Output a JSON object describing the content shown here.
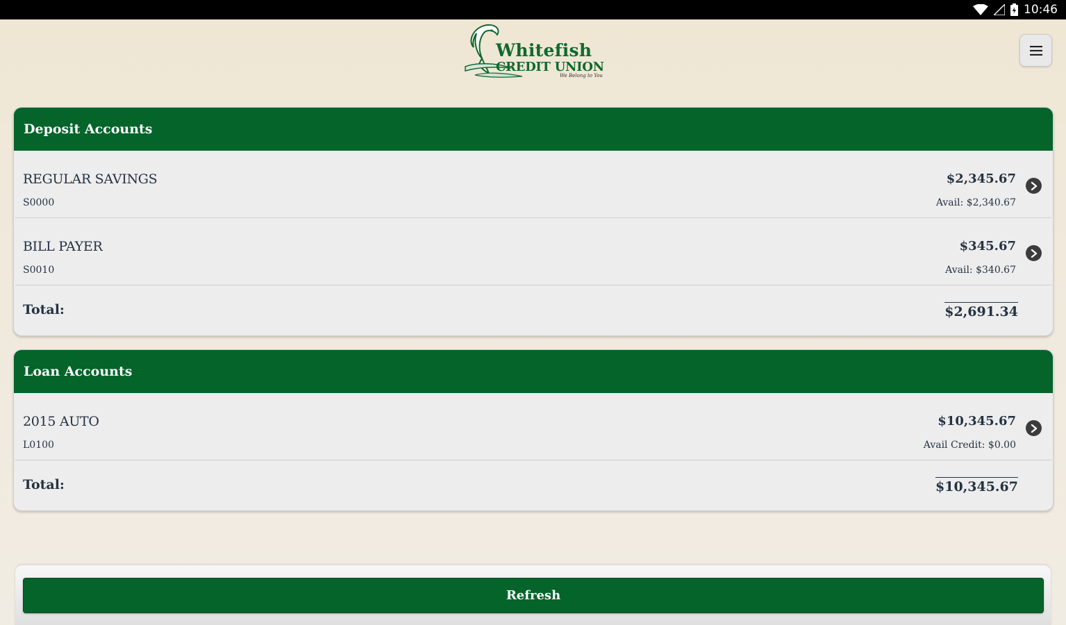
{
  "status_bar": {
    "time": "10:46"
  },
  "header": {
    "logo": {
      "line1": "Whitefish",
      "line2": "CREDIT UNION",
      "tagline": "We Belong to You"
    },
    "menu_icon": "hamburger-menu-icon"
  },
  "deposit": {
    "title": "Deposit Accounts",
    "accounts": [
      {
        "name": "REGULAR SAVINGS",
        "number": "S0000",
        "balance": "$2,345.67",
        "available": "Avail: $2,340.67"
      },
      {
        "name": "BILL PAYER",
        "number": "S0010",
        "balance": "$345.67",
        "available": "Avail: $340.67"
      }
    ],
    "total_label": "Total:",
    "total": "$2,691.34"
  },
  "loan": {
    "title": "Loan Accounts",
    "accounts": [
      {
        "name": "2015 AUTO",
        "number": "L0100",
        "balance": "$10,345.67",
        "available": "Avail Credit: $0.00"
      }
    ],
    "total_label": "Total:",
    "total": "$10,345.67"
  },
  "refresh": {
    "label": "Refresh"
  },
  "colors": {
    "brand_green": "#04642a",
    "text": "#243242"
  }
}
